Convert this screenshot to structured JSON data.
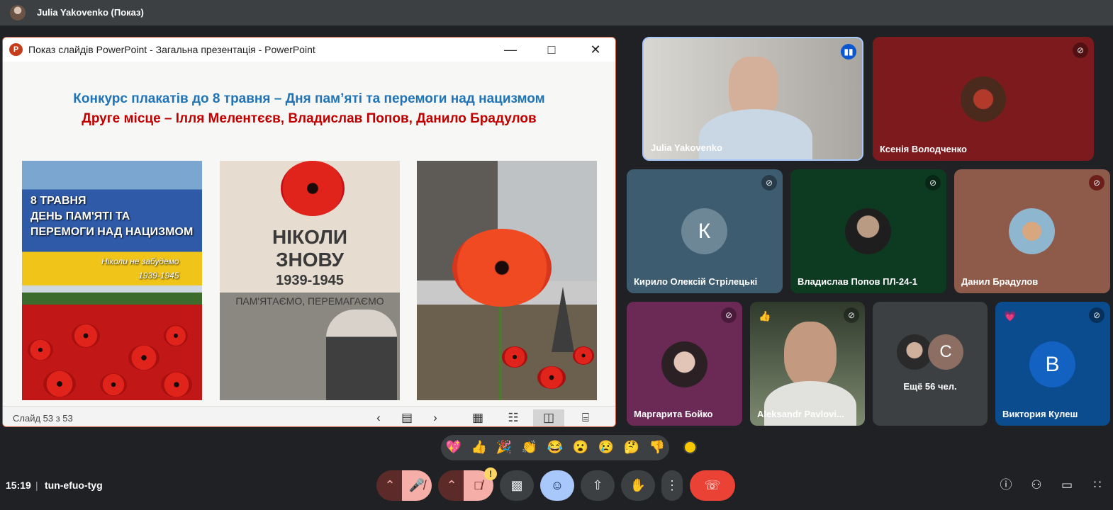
{
  "top_bar": {
    "presenter_name": "Julia Yakovenko (Показ)"
  },
  "ppt": {
    "window_title": "Показ слайдів PowerPoint  -  Загальна презентація - PowerPoint",
    "app_icon": "P",
    "slide_title_line1": "Конкурс плакатів до 8 травня – Дня пам’яті та перемоги над нацизмом",
    "slide_title_line2": "Друге місце – Ілля Мелентєєв, Владислав Попов, Данило Брадулов",
    "poster1_text": [
      "8 ТРАВНЯ",
      "ДЕНЬ ПАМ'ЯТІ ТА",
      "ПЕРЕМОГИ НАД НАЦИЗМОМ"
    ],
    "poster1_sub": [
      "Ніколи не забудемо",
      "1939-1945"
    ],
    "poster2_text": [
      "НІКОЛИ",
      "ЗНОВУ",
      "1939-1945",
      "ПАМ'ЯТАЄМО, ПЕРЕМАГАЄМО"
    ],
    "status_text": "Слайд 53 з 53"
  },
  "participants": [
    {
      "name": "Julia Yakovenko",
      "status": "speaking"
    },
    {
      "name": "Ксенія Володченко",
      "status": "muted"
    },
    {
      "name": "Кирило Олексій Стрілецькі",
      "initial": "К",
      "status": "muted"
    },
    {
      "name": "Владислав Попов ПЛ-24-1",
      "status": "muted"
    },
    {
      "name": "Данил Брадулов",
      "status": "muted"
    },
    {
      "name": "Маргарита Бойко",
      "status": "muted"
    },
    {
      "name": "Aleksandr Pavlovi...",
      "reaction": "👍",
      "status": "muted"
    },
    {
      "name": "Ещё 56 чел.",
      "initial": "С"
    },
    {
      "name": "Виктория Кулеш",
      "initial": "В",
      "reaction": "💗",
      "status": "muted"
    }
  ],
  "reactions": [
    "💖",
    "👍",
    "🎉",
    "👏",
    "😂",
    "😮",
    "😢",
    "🤔",
    "👎"
  ],
  "meeting": {
    "time": "15:19",
    "separator": "|",
    "code": "tun-efuo-tyg"
  },
  "controls": {
    "mic_expand_icon": "chevron-up-icon",
    "mic_icon": "mic-off-icon",
    "cam_icon": "camera-off-icon",
    "warning_badge": "!",
    "end_call_icon": "phone-hangup-icon"
  },
  "colors": {
    "accent_blue": "#a8c7fa",
    "end_call": "#ea4335",
    "mic_off": "#f6aea9"
  }
}
